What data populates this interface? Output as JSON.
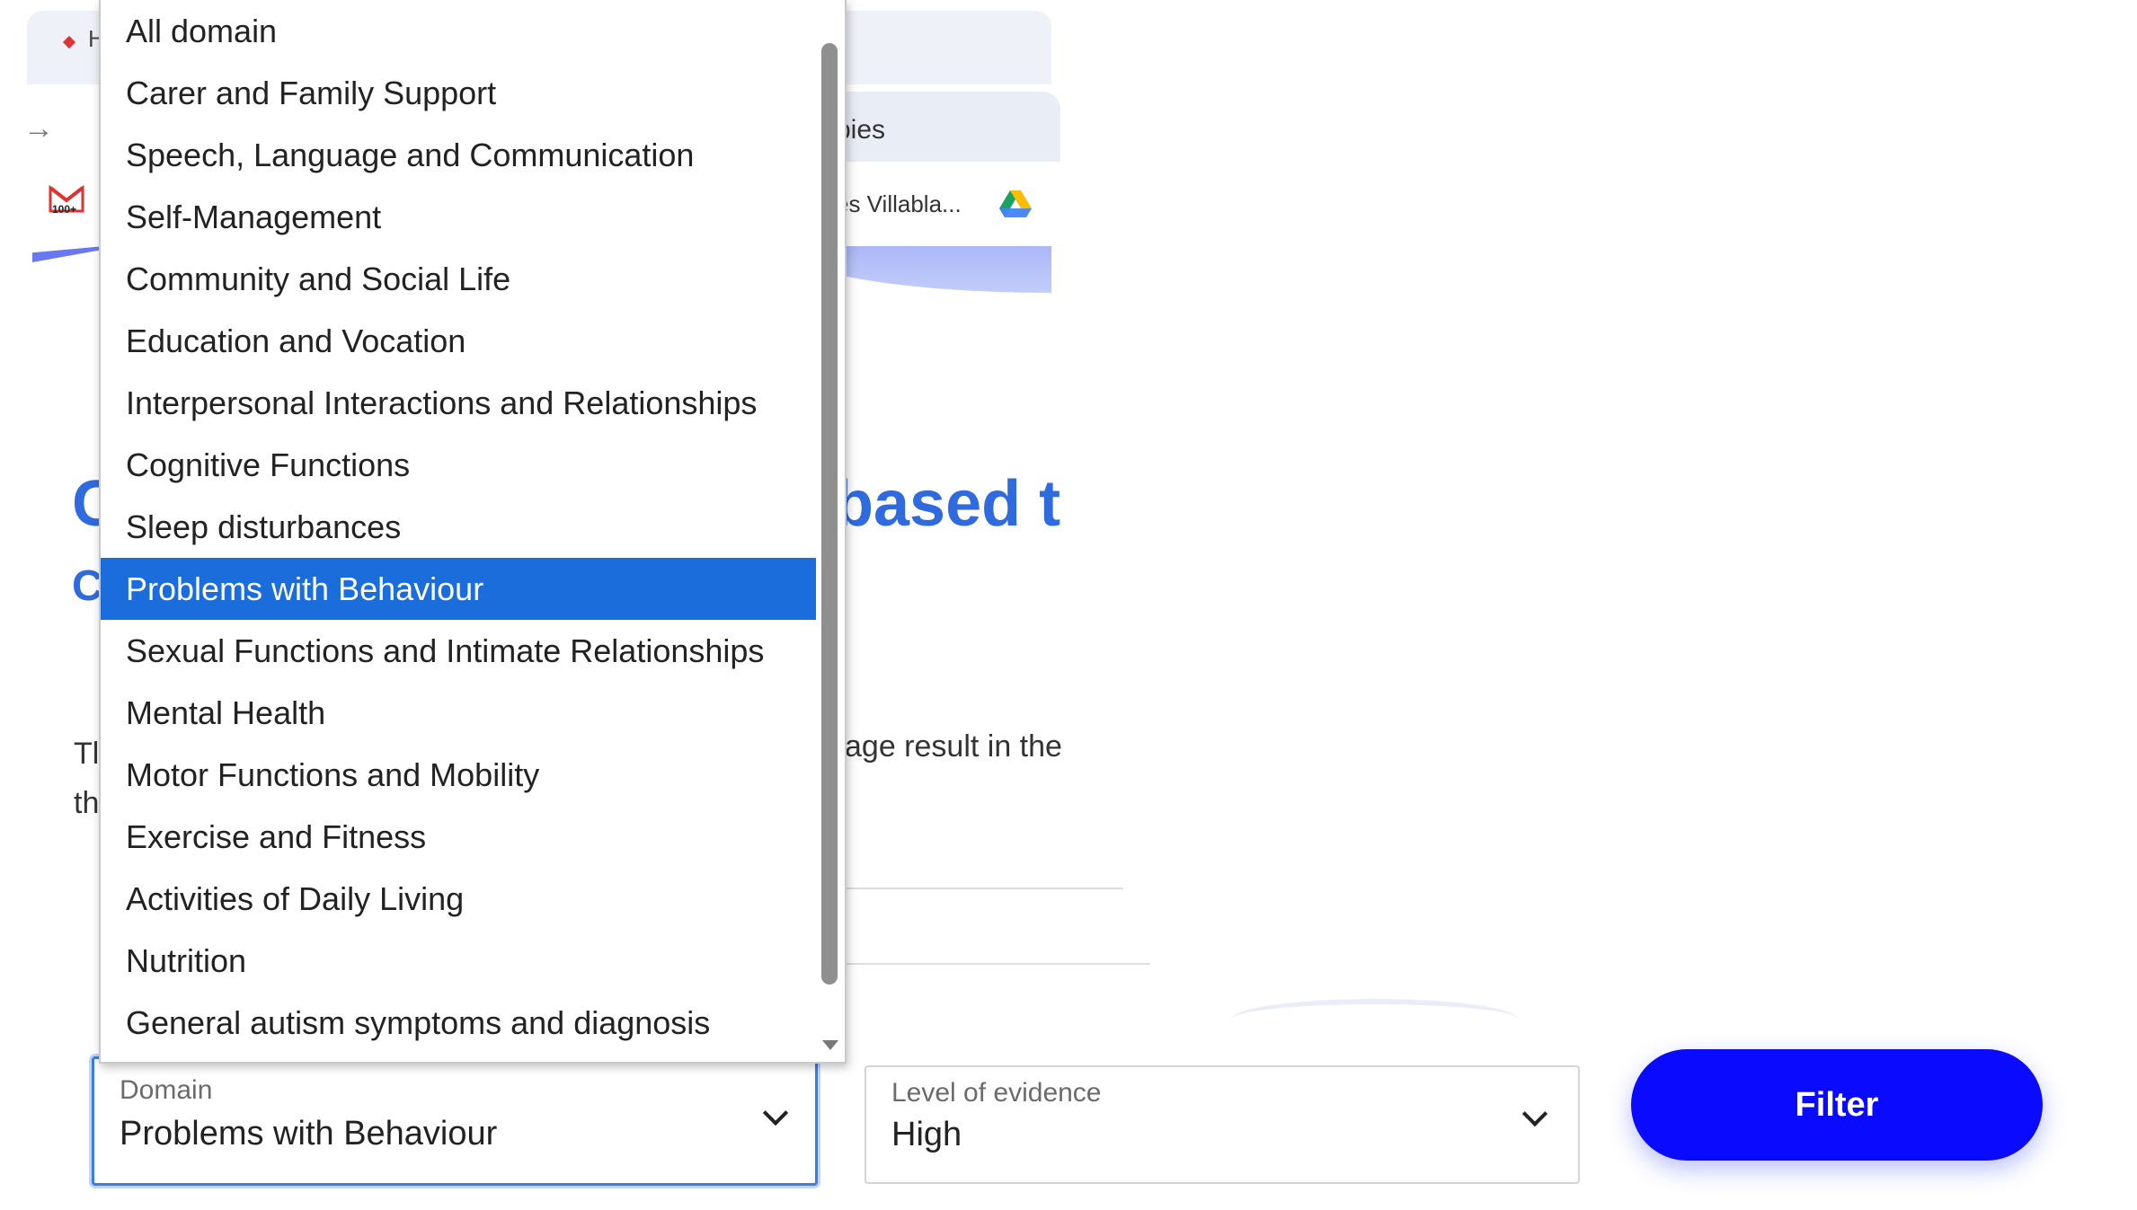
{
  "browser": {
    "tab_home_label": "Ho",
    "active_tab_label": "pies",
    "bookmark_label": "es Villabla...",
    "gmail_badge": "100+"
  },
  "hero": {
    "title_left": "C",
    "title_right": "based t",
    "line2_left": "C"
  },
  "body": {
    "line1_left": "Tl",
    "line2_left": "th",
    "line1_right": "age result in the"
  },
  "domain_select": {
    "label": "Domain",
    "value": "Problems with Behaviour",
    "options": [
      "All domain",
      "Carer and Family Support",
      "Speech, Language and Communication",
      "Self-Management",
      "Community and Social Life",
      "Education and Vocation",
      "Interpersonal Interactions and Relationships",
      "Cognitive Functions",
      "Sleep disturbances",
      "Problems with Behaviour",
      "Sexual Functions and Intimate Relationships",
      "Mental Health",
      "Motor Functions and Mobility",
      "Exercise and Fitness",
      "Activities of Daily Living",
      "Nutrition",
      "General autism symptoms and diagnosis"
    ],
    "selected_index": 9
  },
  "evidence_select": {
    "label": "Level of evidence",
    "value": "High"
  },
  "filter_button": {
    "label": "Filter"
  },
  "colors": {
    "accent": "#0a0aff",
    "highlight": "#1a6ddb",
    "title_blue": "#2f6bdf"
  }
}
